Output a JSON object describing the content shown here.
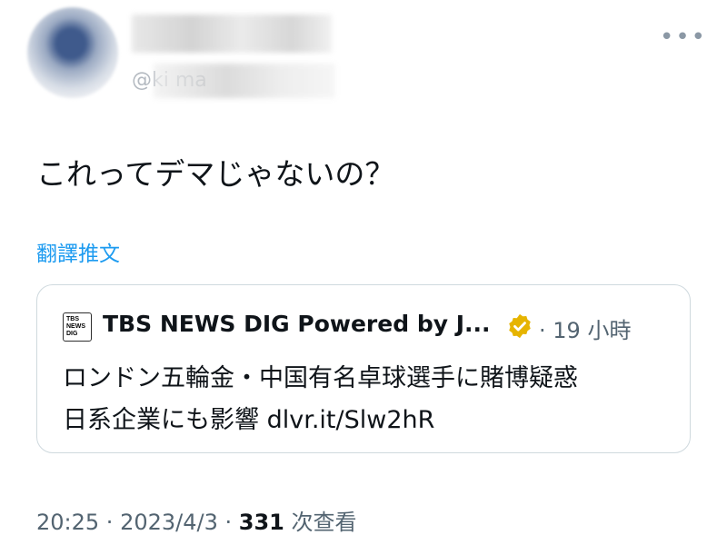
{
  "author": {
    "handle_visible": "@ki   ma"
  },
  "more_icon": "more-horizontal-icon",
  "tweet": {
    "text": "これってデマじゃないの？",
    "translate_label": "翻譯推文"
  },
  "quoted": {
    "logo_lines": [
      "TBS",
      "NEWS",
      "DIG"
    ],
    "source": "TBS NEWS DIG Powered by J...",
    "verified_icon": "verified-badge-icon",
    "badge_color": "#e6b400",
    "separator": "·",
    "time": "19 小時",
    "line1": "ロンドン五輪金・中国有名卓球選手に賭博疑惑",
    "line2": "日系企業にも影響 dlvr.it/Slw2hR"
  },
  "meta": {
    "time": "20:25",
    "separator": " · ",
    "date": "2023/4/3",
    "views_count": "331",
    "views_label": "次查看"
  },
  "colors": {
    "accent": "#1d9bf0",
    "text": "#0f1419",
    "secondary": "#536471",
    "border": "#cfd9de"
  }
}
